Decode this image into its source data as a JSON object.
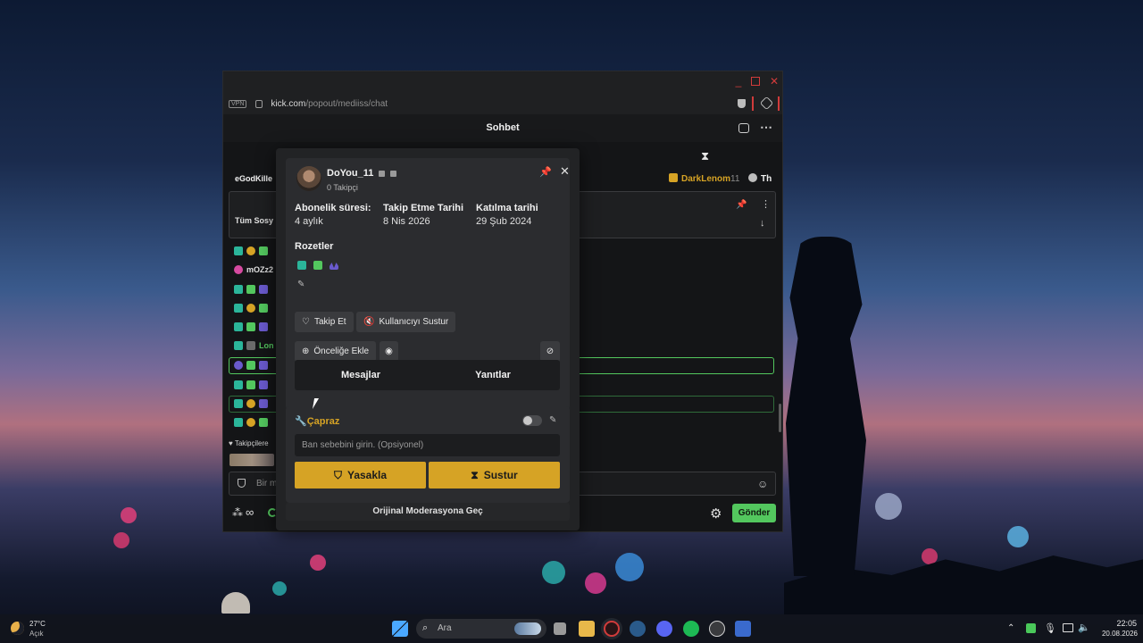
{
  "browser": {
    "vpn_label": "VPN",
    "url_host": "kick.com",
    "url_path": "/popout/mediiss/chat",
    "header_title": "Sohbet"
  },
  "chat_behind": {
    "pinned_names": [
      "eGodKille",
      "DarkLenom",
      "11",
      "Th"
    ],
    "pinned_text": "Tüm Sosy",
    "names": [
      "mOZz2",
      "Lon"
    ],
    "followers_only": "Takipçilere",
    "input_placeholder": "Bir m",
    "send_label": "Gönder"
  },
  "user_card": {
    "username": "DoYou_11",
    "followers": "0 Takipçi",
    "stats": [
      {
        "label": "Abonelik süresi:",
        "value": "4 aylık"
      },
      {
        "label": "Takip Etme Tarihi",
        "value": "8 Nis 2026"
      },
      {
        "label": "Katılma tarihi",
        "value": "29 Şub 2024"
      }
    ],
    "badges_heading": "Rozetler",
    "follow_label": "Takip Et",
    "mute_user_label": "Kullanıcıyı Sustur",
    "priority_label": "Önceliğe Ekle",
    "tab_messages": "Mesajlar",
    "tab_replies": "Yanıtlar"
  },
  "moderation": {
    "preset_label": "Çapraz",
    "ban_placeholder": "Ban sebebini girin. (Opsiyonel)",
    "ban_label": "Yasakla",
    "timeout_label": "Sustur",
    "original_label": "Orijinal Moderasyona Geç"
  },
  "taskbar": {
    "weather_temp": "27°C",
    "weather_desc": "Açık",
    "search_placeholder": "Ara",
    "time": "22:05",
    "date": "20.08.2026"
  },
  "colors": {
    "accent_gold": "#d6a325",
    "kick_green": "#53fc18",
    "window_bg": "#1a1b1d"
  }
}
